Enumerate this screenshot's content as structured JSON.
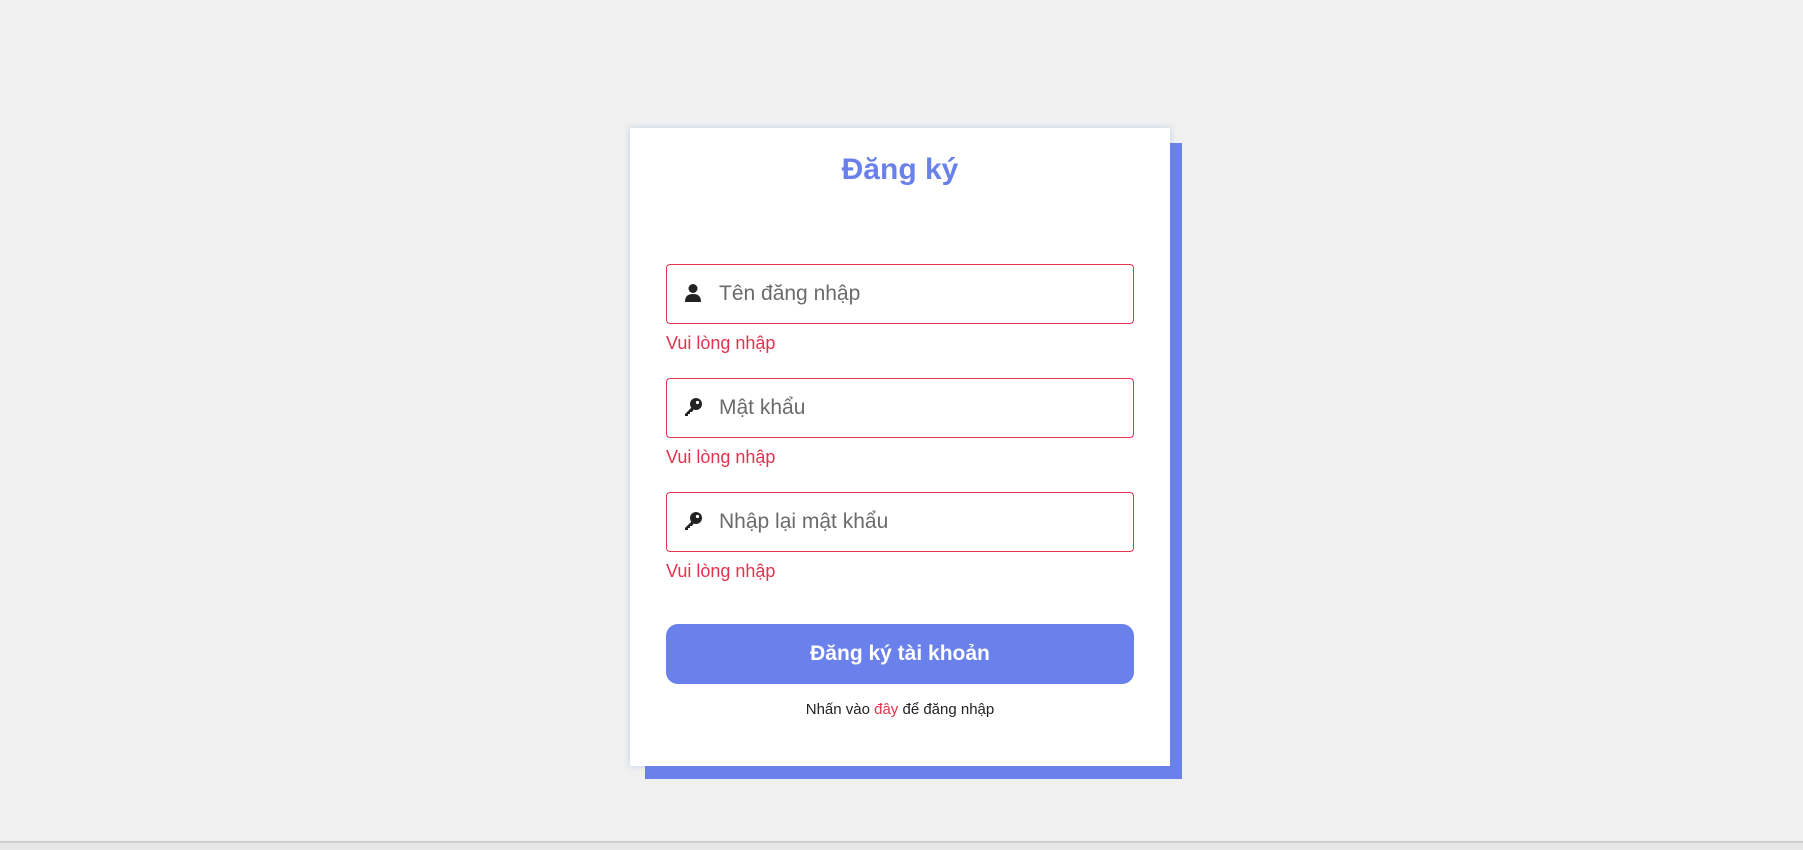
{
  "register_form": {
    "title": "Đăng ký",
    "username": {
      "icon": "user-icon",
      "placeholder": "Tên đăng nhập",
      "value": "",
      "error": "Vui lòng nhập"
    },
    "password": {
      "icon": "key-icon",
      "placeholder": "Mật khẩu",
      "value": "",
      "error": "Vui lòng nhập"
    },
    "confirm_password": {
      "icon": "key-icon",
      "placeholder": "Nhập lại mật khẩu",
      "value": "",
      "error": "Vui lòng nhập"
    },
    "submit_label": "Đăng ký tài khoản",
    "footer": {
      "prefix": "Nhấn vào ",
      "link_text": "đây",
      "suffix": " để đăng nhập"
    }
  },
  "colors": {
    "accent": "#6a80ea",
    "error": "#e2334f",
    "background": "#f0f0f0",
    "card": "#ffffff"
  }
}
